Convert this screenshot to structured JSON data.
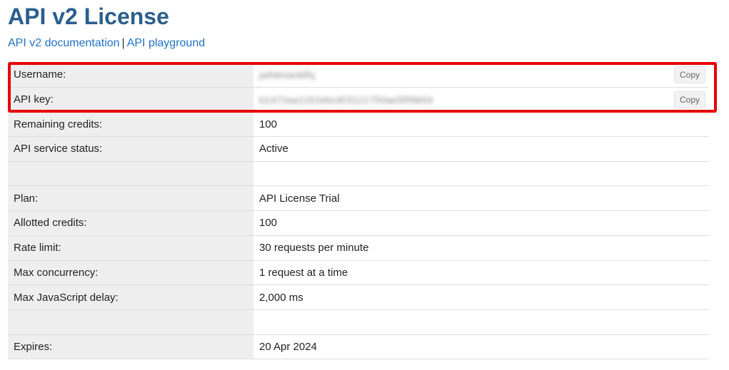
{
  "page": {
    "title": "API v2 License",
    "links": {
      "documentation": "API v2 documentation",
      "separator": "|",
      "playground": "API playground"
    }
  },
  "credentials": {
    "username": {
      "label": "Username:",
      "value": "jwhitmanbfhj",
      "copy_label": "Copy"
    },
    "api_key": {
      "label": "API key:",
      "value": "b1472aa1162ebcd03121750ae5f99b54",
      "copy_label": "Copy"
    }
  },
  "details": [
    {
      "label": "Remaining credits:",
      "value": "100"
    },
    {
      "label": "API service status:",
      "value": "Active"
    },
    {
      "label": "",
      "value": ""
    },
    {
      "label": "Plan:",
      "value": "API License Trial"
    },
    {
      "label": "Allotted credits:",
      "value": "100"
    },
    {
      "label": "Rate limit:",
      "value": "30 requests per minute"
    },
    {
      "label": "Max concurrency:",
      "value": "1 request at a time"
    },
    {
      "label": "Max JavaScript delay:",
      "value": "2,000 ms"
    },
    {
      "label": "",
      "value": ""
    },
    {
      "label": "Expires:",
      "value": "20 Apr 2024"
    }
  ],
  "colors": {
    "title": "#2b5f8e",
    "link": "#1f72c8",
    "highlight": "#e60000",
    "label_bg": "#eeeeee"
  }
}
